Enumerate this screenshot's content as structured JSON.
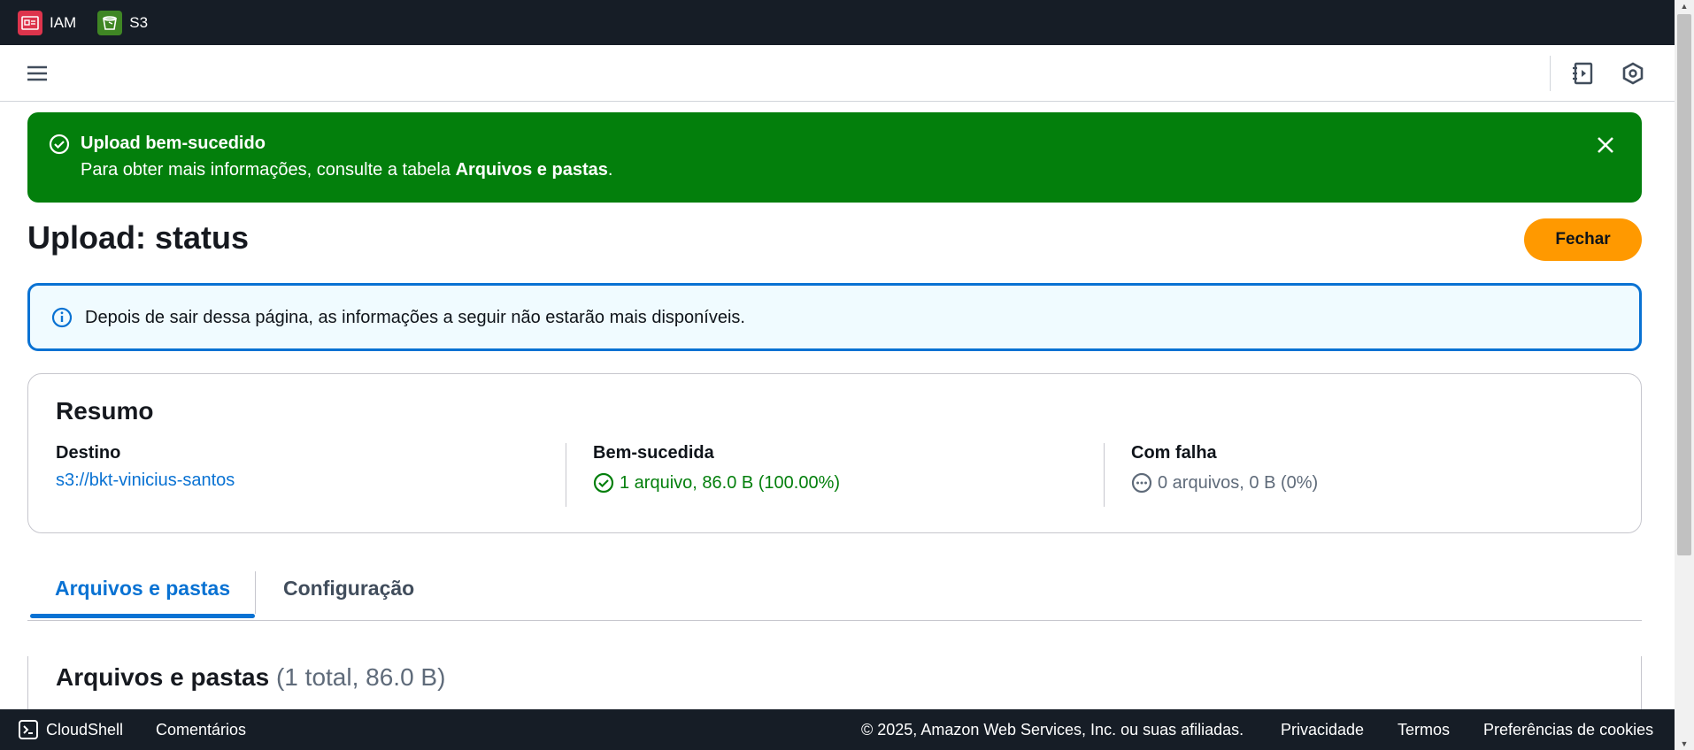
{
  "topbar": {
    "services": [
      {
        "label": "IAM",
        "icon": "iam-icon",
        "color": "#dd344c"
      },
      {
        "label": "S3",
        "icon": "s3-bucket-icon",
        "color": "#3f8624"
      }
    ]
  },
  "flash": {
    "title": "Upload bem-sucedido",
    "body_prefix": "Para obter mais informações, consulte a tabela ",
    "body_bold": "Arquivos e pastas",
    "body_suffix": ".",
    "color": "#037f0c"
  },
  "page": {
    "title": "Upload: status",
    "close_button": "Fechar"
  },
  "info_alert": {
    "text": "Depois de sair dessa página, as informações a seguir não estarão mais disponíveis."
  },
  "summary": {
    "title": "Resumo",
    "destination": {
      "label": "Destino",
      "value": "s3://bkt-vinicius-santos"
    },
    "succeeded": {
      "label": "Bem-sucedida",
      "value": "1 arquivo, 86.0 B (100.00%)"
    },
    "failed": {
      "label": "Com falha",
      "value": "0 arquivos, 0 B (0%)"
    }
  },
  "tabs": [
    {
      "label": "Arquivos e pastas",
      "active": true
    },
    {
      "label": "Configuração",
      "active": false
    }
  ],
  "files_section": {
    "title": "Arquivos e pastas",
    "count": "(1 total, 86.0 B)"
  },
  "footer": {
    "cloudshell": "CloudShell",
    "comments": "Comentários",
    "copyright": "© 2025, Amazon Web Services, Inc. ou suas afiliadas.",
    "privacy": "Privacidade",
    "terms": "Termos",
    "cookies": "Preferências de cookies"
  }
}
